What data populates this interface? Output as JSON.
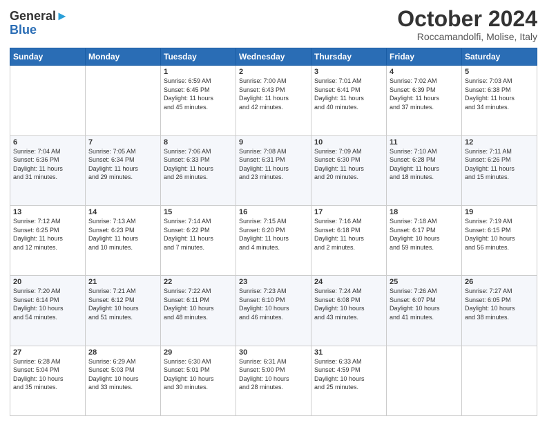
{
  "logo": {
    "line1": "General",
    "line2": "Blue"
  },
  "header": {
    "month": "October 2024",
    "location": "Roccamandolfi, Molise, Italy"
  },
  "weekdays": [
    "Sunday",
    "Monday",
    "Tuesday",
    "Wednesday",
    "Thursday",
    "Friday",
    "Saturday"
  ],
  "weeks": [
    [
      {
        "day": "",
        "info": ""
      },
      {
        "day": "",
        "info": ""
      },
      {
        "day": "1",
        "info": "Sunrise: 6:59 AM\nSunset: 6:45 PM\nDaylight: 11 hours\nand 45 minutes."
      },
      {
        "day": "2",
        "info": "Sunrise: 7:00 AM\nSunset: 6:43 PM\nDaylight: 11 hours\nand 42 minutes."
      },
      {
        "day": "3",
        "info": "Sunrise: 7:01 AM\nSunset: 6:41 PM\nDaylight: 11 hours\nand 40 minutes."
      },
      {
        "day": "4",
        "info": "Sunrise: 7:02 AM\nSunset: 6:39 PM\nDaylight: 11 hours\nand 37 minutes."
      },
      {
        "day": "5",
        "info": "Sunrise: 7:03 AM\nSunset: 6:38 PM\nDaylight: 11 hours\nand 34 minutes."
      }
    ],
    [
      {
        "day": "6",
        "info": "Sunrise: 7:04 AM\nSunset: 6:36 PM\nDaylight: 11 hours\nand 31 minutes."
      },
      {
        "day": "7",
        "info": "Sunrise: 7:05 AM\nSunset: 6:34 PM\nDaylight: 11 hours\nand 29 minutes."
      },
      {
        "day": "8",
        "info": "Sunrise: 7:06 AM\nSunset: 6:33 PM\nDaylight: 11 hours\nand 26 minutes."
      },
      {
        "day": "9",
        "info": "Sunrise: 7:08 AM\nSunset: 6:31 PM\nDaylight: 11 hours\nand 23 minutes."
      },
      {
        "day": "10",
        "info": "Sunrise: 7:09 AM\nSunset: 6:30 PM\nDaylight: 11 hours\nand 20 minutes."
      },
      {
        "day": "11",
        "info": "Sunrise: 7:10 AM\nSunset: 6:28 PM\nDaylight: 11 hours\nand 18 minutes."
      },
      {
        "day": "12",
        "info": "Sunrise: 7:11 AM\nSunset: 6:26 PM\nDaylight: 11 hours\nand 15 minutes."
      }
    ],
    [
      {
        "day": "13",
        "info": "Sunrise: 7:12 AM\nSunset: 6:25 PM\nDaylight: 11 hours\nand 12 minutes."
      },
      {
        "day": "14",
        "info": "Sunrise: 7:13 AM\nSunset: 6:23 PM\nDaylight: 11 hours\nand 10 minutes."
      },
      {
        "day": "15",
        "info": "Sunrise: 7:14 AM\nSunset: 6:22 PM\nDaylight: 11 hours\nand 7 minutes."
      },
      {
        "day": "16",
        "info": "Sunrise: 7:15 AM\nSunset: 6:20 PM\nDaylight: 11 hours\nand 4 minutes."
      },
      {
        "day": "17",
        "info": "Sunrise: 7:16 AM\nSunset: 6:18 PM\nDaylight: 11 hours\nand 2 minutes."
      },
      {
        "day": "18",
        "info": "Sunrise: 7:18 AM\nSunset: 6:17 PM\nDaylight: 10 hours\nand 59 minutes."
      },
      {
        "day": "19",
        "info": "Sunrise: 7:19 AM\nSunset: 6:15 PM\nDaylight: 10 hours\nand 56 minutes."
      }
    ],
    [
      {
        "day": "20",
        "info": "Sunrise: 7:20 AM\nSunset: 6:14 PM\nDaylight: 10 hours\nand 54 minutes."
      },
      {
        "day": "21",
        "info": "Sunrise: 7:21 AM\nSunset: 6:12 PM\nDaylight: 10 hours\nand 51 minutes."
      },
      {
        "day": "22",
        "info": "Sunrise: 7:22 AM\nSunset: 6:11 PM\nDaylight: 10 hours\nand 48 minutes."
      },
      {
        "day": "23",
        "info": "Sunrise: 7:23 AM\nSunset: 6:10 PM\nDaylight: 10 hours\nand 46 minutes."
      },
      {
        "day": "24",
        "info": "Sunrise: 7:24 AM\nSunset: 6:08 PM\nDaylight: 10 hours\nand 43 minutes."
      },
      {
        "day": "25",
        "info": "Sunrise: 7:26 AM\nSunset: 6:07 PM\nDaylight: 10 hours\nand 41 minutes."
      },
      {
        "day": "26",
        "info": "Sunrise: 7:27 AM\nSunset: 6:05 PM\nDaylight: 10 hours\nand 38 minutes."
      }
    ],
    [
      {
        "day": "27",
        "info": "Sunrise: 6:28 AM\nSunset: 5:04 PM\nDaylight: 10 hours\nand 35 minutes."
      },
      {
        "day": "28",
        "info": "Sunrise: 6:29 AM\nSunset: 5:03 PM\nDaylight: 10 hours\nand 33 minutes."
      },
      {
        "day": "29",
        "info": "Sunrise: 6:30 AM\nSunset: 5:01 PM\nDaylight: 10 hours\nand 30 minutes."
      },
      {
        "day": "30",
        "info": "Sunrise: 6:31 AM\nSunset: 5:00 PM\nDaylight: 10 hours\nand 28 minutes."
      },
      {
        "day": "31",
        "info": "Sunrise: 6:33 AM\nSunset: 4:59 PM\nDaylight: 10 hours\nand 25 minutes."
      },
      {
        "day": "",
        "info": ""
      },
      {
        "day": "",
        "info": ""
      }
    ]
  ]
}
